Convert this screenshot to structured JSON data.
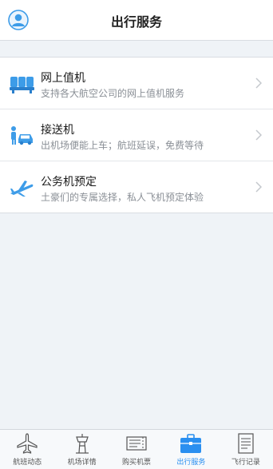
{
  "header": {
    "title": "出行服务"
  },
  "services": [
    {
      "icon": "seat-checkin-icon",
      "title": "网上值机",
      "subtitle": "支持各大航空公司的网上值机服务"
    },
    {
      "icon": "car-pickup-icon",
      "title": "接送机",
      "subtitle": "出机场便能上车；航班延误，免费等待"
    },
    {
      "icon": "private-jet-icon",
      "title": "公务机预定",
      "subtitle": "土豪们的专属选择，私人飞机预定体验"
    }
  ],
  "tabs": [
    {
      "icon": "airplane-icon",
      "label": "航班动态",
      "active": false
    },
    {
      "icon": "control-tower-icon",
      "label": "机场详情",
      "active": false
    },
    {
      "icon": "ticket-icon",
      "label": "购买机票",
      "active": false
    },
    {
      "icon": "briefcase-icon",
      "label": "出行服务",
      "active": true
    },
    {
      "icon": "logbook-icon",
      "label": "飞行记录",
      "active": false
    }
  ],
  "colors": {
    "accent": "#2a8ff0",
    "background": "#eff3f7",
    "icon_blue": "#3d9ce8"
  }
}
